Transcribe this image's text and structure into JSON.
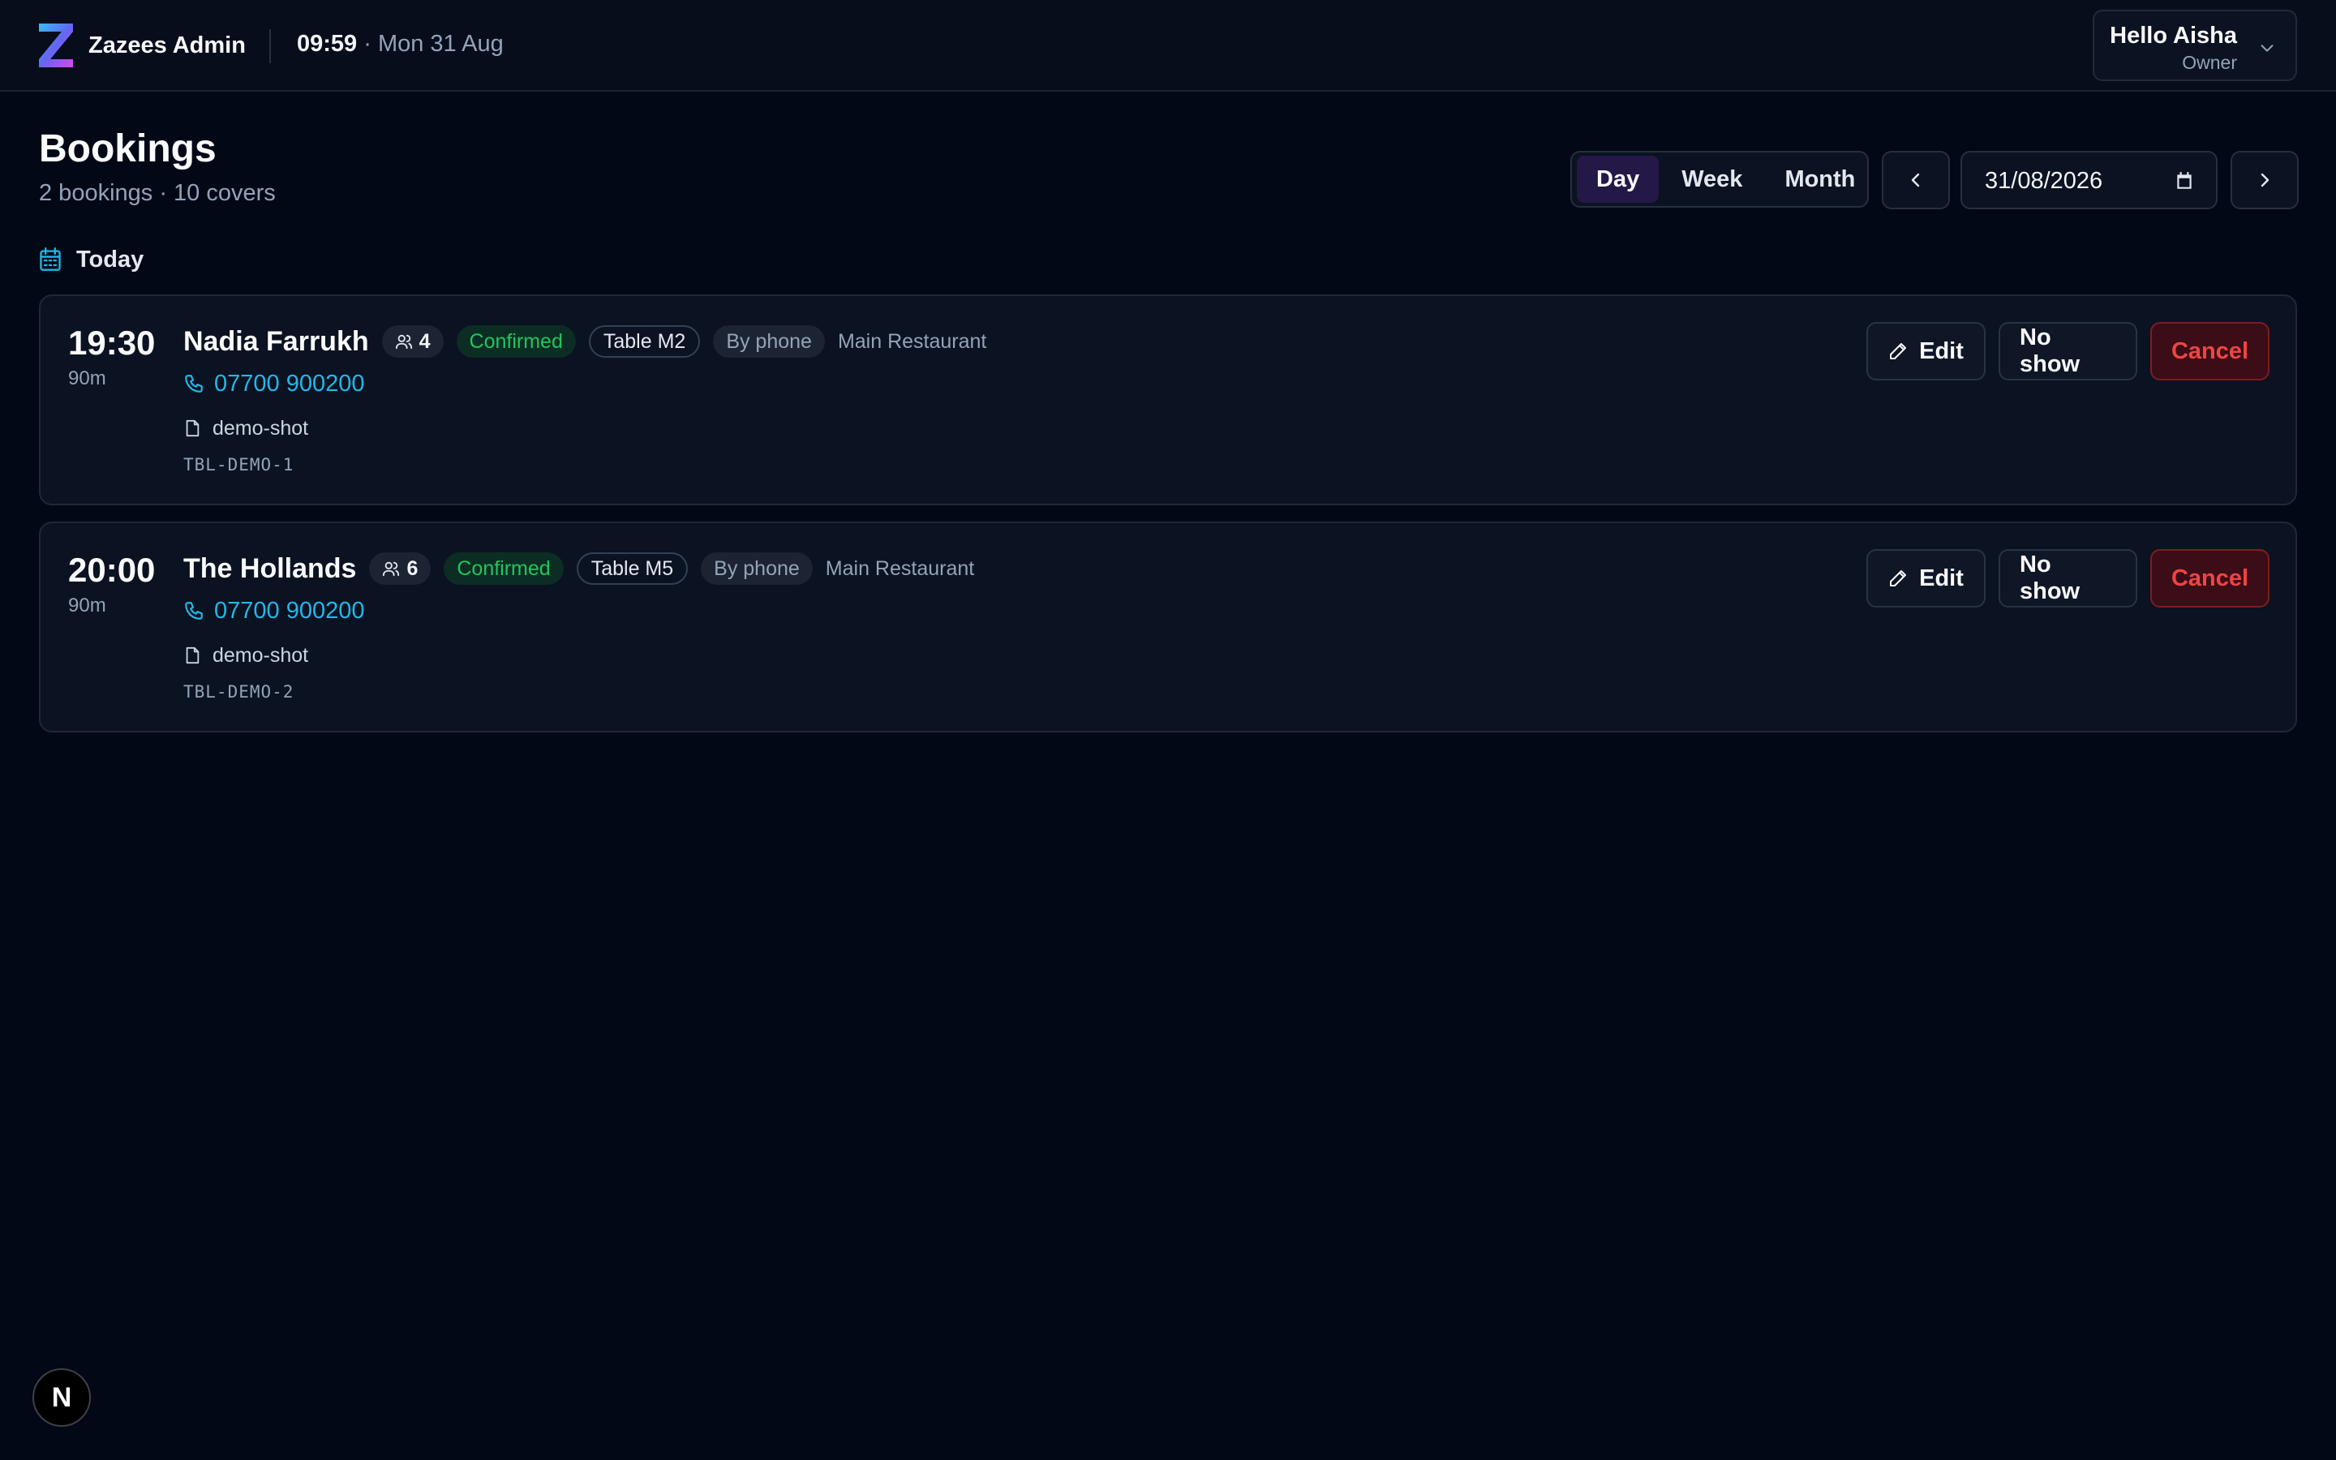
{
  "header": {
    "app_name": "Zazees Admin",
    "time": "09:59",
    "date_suffix": " · Mon 31 Aug",
    "user_greeting": "Hello Aisha",
    "user_role": "Owner"
  },
  "page": {
    "title": "Bookings",
    "subtitle": "2 bookings · 10 covers",
    "section_label": "Today"
  },
  "controls": {
    "views": [
      "Day",
      "Week",
      "Month"
    ],
    "active_view": "Day",
    "date_value": "31/08/2026"
  },
  "bookings": [
    {
      "time": "19:30",
      "duration": "90m",
      "name": "Nadia Farrukh",
      "covers": "4",
      "status": "Confirmed",
      "table": "Table M2",
      "source": "By phone",
      "location": "Main Restaurant",
      "phone": "07700 900200",
      "note": "demo-shot",
      "reference": "TBL-DEMO-1"
    },
    {
      "time": "20:00",
      "duration": "90m",
      "name": "The Hollands",
      "covers": "6",
      "status": "Confirmed",
      "table": "Table M5",
      "source": "By phone",
      "location": "Main Restaurant",
      "phone": "07700 900200",
      "note": "demo-shot",
      "reference": "TBL-DEMO-2"
    }
  ],
  "actions": {
    "edit": "Edit",
    "no_show": "No show",
    "cancel": "Cancel"
  },
  "dev_badge": "N",
  "colors": {
    "background": "#030816",
    "accent": "#241847",
    "phone": "#22b8e8",
    "confirmed": "#22c55e",
    "cancel": "#ef4444"
  }
}
